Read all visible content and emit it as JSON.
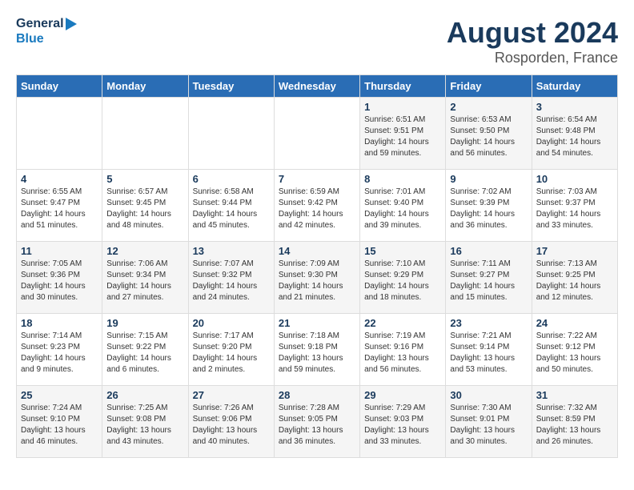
{
  "header": {
    "logo_general": "General",
    "logo_blue": "Blue",
    "title": "August 2024",
    "subtitle": "Rosporden, France"
  },
  "weekdays": [
    "Sunday",
    "Monday",
    "Tuesday",
    "Wednesday",
    "Thursday",
    "Friday",
    "Saturday"
  ],
  "weeks": [
    [
      {
        "day": "",
        "info": ""
      },
      {
        "day": "",
        "info": ""
      },
      {
        "day": "",
        "info": ""
      },
      {
        "day": "",
        "info": ""
      },
      {
        "day": "1",
        "info": "Sunrise: 6:51 AM\nSunset: 9:51 PM\nDaylight: 14 hours\nand 59 minutes."
      },
      {
        "day": "2",
        "info": "Sunrise: 6:53 AM\nSunset: 9:50 PM\nDaylight: 14 hours\nand 56 minutes."
      },
      {
        "day": "3",
        "info": "Sunrise: 6:54 AM\nSunset: 9:48 PM\nDaylight: 14 hours\nand 54 minutes."
      }
    ],
    [
      {
        "day": "4",
        "info": "Sunrise: 6:55 AM\nSunset: 9:47 PM\nDaylight: 14 hours\nand 51 minutes."
      },
      {
        "day": "5",
        "info": "Sunrise: 6:57 AM\nSunset: 9:45 PM\nDaylight: 14 hours\nand 48 minutes."
      },
      {
        "day": "6",
        "info": "Sunrise: 6:58 AM\nSunset: 9:44 PM\nDaylight: 14 hours\nand 45 minutes."
      },
      {
        "day": "7",
        "info": "Sunrise: 6:59 AM\nSunset: 9:42 PM\nDaylight: 14 hours\nand 42 minutes."
      },
      {
        "day": "8",
        "info": "Sunrise: 7:01 AM\nSunset: 9:40 PM\nDaylight: 14 hours\nand 39 minutes."
      },
      {
        "day": "9",
        "info": "Sunrise: 7:02 AM\nSunset: 9:39 PM\nDaylight: 14 hours\nand 36 minutes."
      },
      {
        "day": "10",
        "info": "Sunrise: 7:03 AM\nSunset: 9:37 PM\nDaylight: 14 hours\nand 33 minutes."
      }
    ],
    [
      {
        "day": "11",
        "info": "Sunrise: 7:05 AM\nSunset: 9:36 PM\nDaylight: 14 hours\nand 30 minutes."
      },
      {
        "day": "12",
        "info": "Sunrise: 7:06 AM\nSunset: 9:34 PM\nDaylight: 14 hours\nand 27 minutes."
      },
      {
        "day": "13",
        "info": "Sunrise: 7:07 AM\nSunset: 9:32 PM\nDaylight: 14 hours\nand 24 minutes."
      },
      {
        "day": "14",
        "info": "Sunrise: 7:09 AM\nSunset: 9:30 PM\nDaylight: 14 hours\nand 21 minutes."
      },
      {
        "day": "15",
        "info": "Sunrise: 7:10 AM\nSunset: 9:29 PM\nDaylight: 14 hours\nand 18 minutes."
      },
      {
        "day": "16",
        "info": "Sunrise: 7:11 AM\nSunset: 9:27 PM\nDaylight: 14 hours\nand 15 minutes."
      },
      {
        "day": "17",
        "info": "Sunrise: 7:13 AM\nSunset: 9:25 PM\nDaylight: 14 hours\nand 12 minutes."
      }
    ],
    [
      {
        "day": "18",
        "info": "Sunrise: 7:14 AM\nSunset: 9:23 PM\nDaylight: 14 hours\nand 9 minutes."
      },
      {
        "day": "19",
        "info": "Sunrise: 7:15 AM\nSunset: 9:22 PM\nDaylight: 14 hours\nand 6 minutes."
      },
      {
        "day": "20",
        "info": "Sunrise: 7:17 AM\nSunset: 9:20 PM\nDaylight: 14 hours\nand 2 minutes."
      },
      {
        "day": "21",
        "info": "Sunrise: 7:18 AM\nSunset: 9:18 PM\nDaylight: 13 hours\nand 59 minutes."
      },
      {
        "day": "22",
        "info": "Sunrise: 7:19 AM\nSunset: 9:16 PM\nDaylight: 13 hours\nand 56 minutes."
      },
      {
        "day": "23",
        "info": "Sunrise: 7:21 AM\nSunset: 9:14 PM\nDaylight: 13 hours\nand 53 minutes."
      },
      {
        "day": "24",
        "info": "Sunrise: 7:22 AM\nSunset: 9:12 PM\nDaylight: 13 hours\nand 50 minutes."
      }
    ],
    [
      {
        "day": "25",
        "info": "Sunrise: 7:24 AM\nSunset: 9:10 PM\nDaylight: 13 hours\nand 46 minutes."
      },
      {
        "day": "26",
        "info": "Sunrise: 7:25 AM\nSunset: 9:08 PM\nDaylight: 13 hours\nand 43 minutes."
      },
      {
        "day": "27",
        "info": "Sunrise: 7:26 AM\nSunset: 9:06 PM\nDaylight: 13 hours\nand 40 minutes."
      },
      {
        "day": "28",
        "info": "Sunrise: 7:28 AM\nSunset: 9:05 PM\nDaylight: 13 hours\nand 36 minutes."
      },
      {
        "day": "29",
        "info": "Sunrise: 7:29 AM\nSunset: 9:03 PM\nDaylight: 13 hours\nand 33 minutes."
      },
      {
        "day": "30",
        "info": "Sunrise: 7:30 AM\nSunset: 9:01 PM\nDaylight: 13 hours\nand 30 minutes."
      },
      {
        "day": "31",
        "info": "Sunrise: 7:32 AM\nSunset: 8:59 PM\nDaylight: 13 hours\nand 26 minutes."
      }
    ]
  ]
}
